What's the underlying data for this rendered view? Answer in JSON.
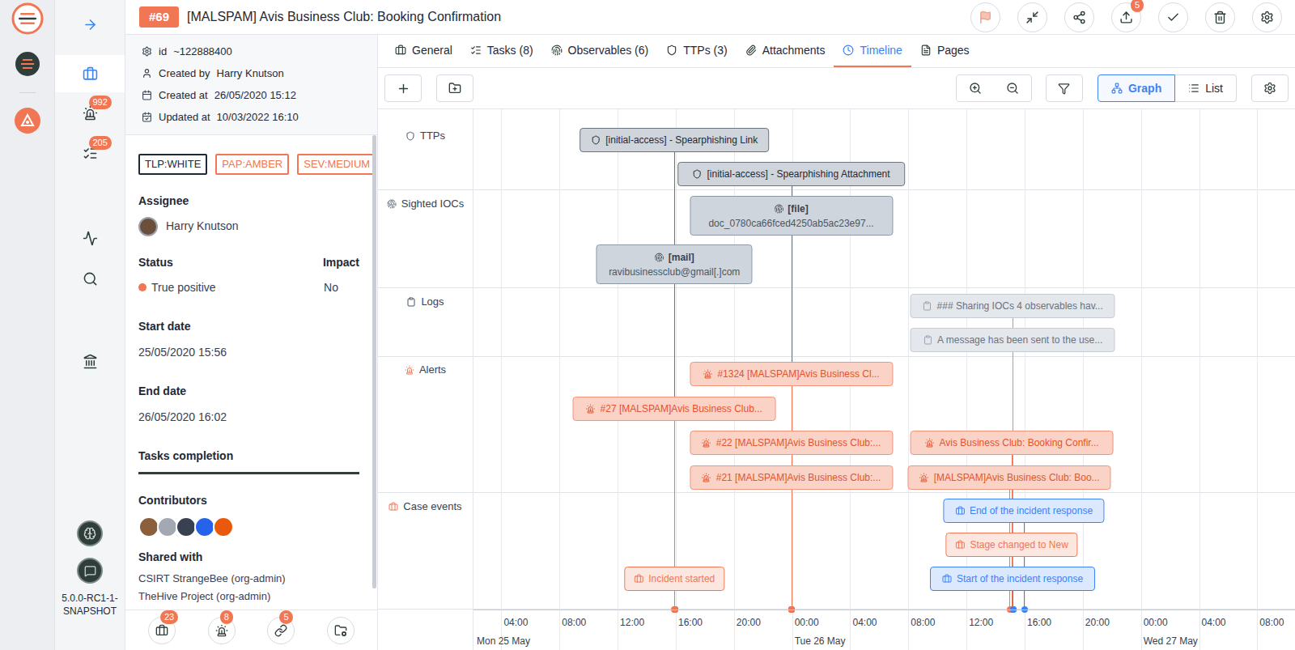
{
  "sidebar": {
    "items": [
      {
        "badge": "",
        "selected": false
      },
      {
        "badge": "",
        "selected": true
      },
      {
        "badge": "992",
        "selected": false
      },
      {
        "badge": "205",
        "selected": false
      },
      {
        "badge": "",
        "selected": false
      },
      {
        "badge": "",
        "selected": false
      },
      {
        "badge": "",
        "selected": false
      }
    ],
    "version": "5.0.0-RC1-1-SNAPSHOT"
  },
  "header": {
    "case_number": "#69",
    "title": "[MALSPAM] Avis Business Club: Booking Confirmation",
    "actions": [
      {
        "badge": ""
      },
      {
        "badge": ""
      },
      {
        "badge": ""
      },
      {
        "badge": "5"
      },
      {
        "badge": ""
      },
      {
        "badge": ""
      },
      {
        "badge": ""
      }
    ]
  },
  "details": {
    "meta": [
      {
        "label": "id",
        "value": "~122888400"
      },
      {
        "label": "Created by",
        "value": "Harry Knutson"
      },
      {
        "label": "Created at",
        "value": "26/05/2020 15:12"
      },
      {
        "label": "Updated at",
        "value": "10/03/2022 16:10"
      }
    ],
    "tags": [
      {
        "label": "TLP:WHITE",
        "color": "#1f2937"
      },
      {
        "label": "PAP:AMBER",
        "color": "#f07654"
      },
      {
        "label": "SEV:MEDIUM",
        "color": "#f07654"
      }
    ],
    "assignee": {
      "label": "Assignee",
      "name": "Harry Knutson",
      "color": "#6b4f3a"
    },
    "status": {
      "label": "Status",
      "value": "True positive",
      "color": "#f07654"
    },
    "impact": {
      "label": "Impact",
      "value": "No"
    },
    "start_date": {
      "label": "Start date",
      "value": "25/05/2020 15:56"
    },
    "end_date": {
      "label": "End date",
      "value": "26/05/2020 16:02"
    },
    "tasks_completion": {
      "label": "Tasks completion",
      "level": 1
    },
    "contributors": {
      "label": "Contributors",
      "avatars": [
        {
          "color": "#8b5e3c"
        },
        {
          "color": "#a3a9b3"
        },
        {
          "color": "#374151"
        },
        {
          "color": "#2563eb"
        },
        {
          "color": "#ea580c"
        }
      ]
    },
    "shared_with": {
      "label": "Shared with",
      "items": [
        "CSIRT StrangeBee (org-admin)",
        "TheHive Project (org-admin)"
      ]
    },
    "footer": [
      {
        "badge": "23"
      },
      {
        "badge": "8"
      },
      {
        "badge": "5"
      },
      {
        "badge": ""
      }
    ]
  },
  "tabs": [
    {
      "label": "General",
      "selected": false
    },
    {
      "label": "Tasks (8)",
      "selected": false
    },
    {
      "label": "Observables (6)",
      "selected": false
    },
    {
      "label": "TTPs (3)",
      "selected": false
    },
    {
      "label": "Attachments",
      "selected": false
    },
    {
      "label": "Timeline",
      "selected": true
    },
    {
      "label": "Pages",
      "selected": false
    }
  ],
  "toolbar": {
    "views": [
      {
        "label": "Graph",
        "selected": true
      },
      {
        "label": "List",
        "selected": false
      }
    ]
  },
  "timeline": {
    "groups": [
      {
        "label": "TTPs",
        "kind": "ttp",
        "items": [
          {
            "title": "[initial-access] - Spearphishing Link",
            "value": "",
            "start": 9.4,
            "end": 22.41,
            "color": "#6b7280"
          },
          {
            "title": "[initial-access] - Spearphishing Attachment",
            "value": "",
            "start": 16.1,
            "end": 31.78,
            "color": "#6b7280"
          }
        ]
      },
      {
        "label": "Sighted IOCs",
        "kind": "ioc",
        "items": [
          {
            "title": "[file]",
            "value": "doc_0780ca66fced4250ab5ac23e97...",
            "start": 16.95,
            "end": 30.93,
            "color": "#6b7280"
          },
          {
            "title": "[mail]",
            "value": "ravibusinessclub@gmail[.]com",
            "start": 10.53,
            "end": 21.28,
            "color": "#6b7280"
          }
        ]
      },
      {
        "label": "Logs",
        "kind": "log",
        "items": [
          {
            "title": "### Sharing IOCs 4 observables hav...",
            "value": "",
            "start": 32.13,
            "end": 46.22,
            "color": "#9ca3af"
          },
          {
            "title": "A message has been sent to the use...",
            "value": "",
            "start": 32.13,
            "end": 46.22,
            "color": "#9ca3af"
          }
        ]
      },
      {
        "label": "Alerts",
        "kind": "alert",
        "items": [
          {
            "title": "#1324 [MALSPAM]Avis Business Cl...",
            "value": "",
            "start": 16.95,
            "end": 30.93,
            "color": "#f07654"
          },
          {
            "title": "#27 [MALSPAM]Avis Business Club...",
            "value": "",
            "start": 8.89,
            "end": 22.86,
            "color": "#f07654"
          },
          {
            "title": "#22 [MALSPAM]Avis Business Club:...",
            "value": "",
            "start": 16.95,
            "end": 30.93,
            "color": "#f07654"
          },
          {
            "title": "Avis Business Club: Booking Confir...",
            "value": "",
            "start": 32.13,
            "end": 46.1,
            "color": "#f07654"
          },
          {
            "title": "#21 [MALSPAM]Avis Business Club:...",
            "value": "",
            "start": 16.95,
            "end": 30.93,
            "color": "#f07654"
          },
          {
            "title": "[MALSPAM]Avis Business Club: Boo...",
            "value": "",
            "start": 31.96,
            "end": 45.94,
            "color": "#f07654"
          }
        ]
      },
      {
        "label": "Case events",
        "kind": "event",
        "items": [
          {
            "title": "End of the incident response",
            "value": "",
            "start": 34.4,
            "end": 45.49,
            "color": "#3b82f6"
          },
          {
            "title": "Stage changed to New",
            "value": "",
            "start": 34.57,
            "end": 43.66,
            "color": "#f07654"
          },
          {
            "title": "Start of the incident response",
            "value": "",
            "start": 33.49,
            "end": 44.85,
            "color": "#3b82f6"
          },
          {
            "title": "Incident started",
            "value": "",
            "start": 12.47,
            "end": 19.34,
            "color": "#f07654"
          }
        ]
      }
    ],
    "axis": {
      "ticks": [
        {
          "label": "04:00",
          "hour": 4
        },
        {
          "label": "08:00",
          "hour": 8
        },
        {
          "label": "12:00",
          "hour": 12
        },
        {
          "label": "16:00",
          "hour": 16
        },
        {
          "label": "20:00",
          "hour": 20
        },
        {
          "label": "00:00",
          "hour": 24
        },
        {
          "label": "04:00",
          "hour": 28
        },
        {
          "label": "08:00",
          "hour": 32
        },
        {
          "label": "12:00",
          "hour": 36
        },
        {
          "label": "16:00",
          "hour": 40
        },
        {
          "label": "20:00",
          "hour": 44
        },
        {
          "label": "00:00",
          "hour": 48
        },
        {
          "label": "04:00",
          "hour": 52
        },
        {
          "label": "08:00",
          "hour": 56
        }
      ],
      "days": [
        {
          "label": "Mon 25 May",
          "hour": 0
        },
        {
          "label": "Tue 26 May",
          "hour": 24
        },
        {
          "label": "Wed 27 May",
          "hour": 48
        }
      ]
    }
  }
}
